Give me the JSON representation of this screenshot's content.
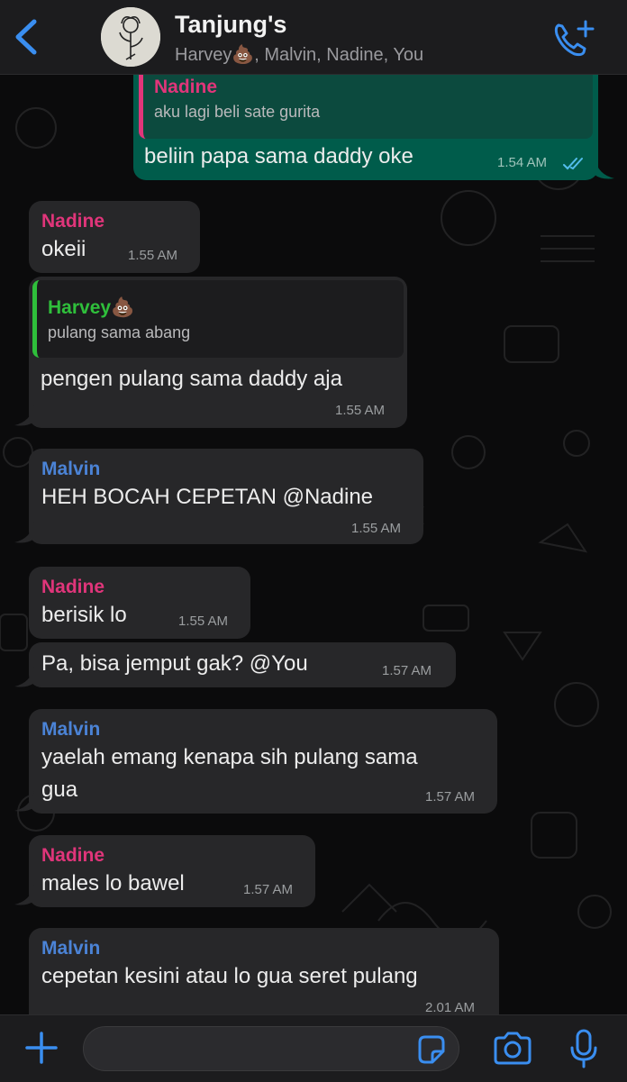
{
  "header": {
    "title": "Tanjung's",
    "members": "Harvey💩, Malvin, Nadine, You"
  },
  "messages": [
    {
      "sender": "Nadine",
      "quote_text": "aku lagi beli sate gurita",
      "text": "beliin papa sama daddy oke",
      "time": "1.54 AM",
      "status": "read"
    },
    {
      "sender": "Nadine",
      "text": "okeii",
      "time": "1.55 AM"
    },
    {
      "quote_sender": "Harvey💩",
      "quote_text": "pulang sama abang",
      "text": "pengen pulang sama daddy aja",
      "time": "1.55 AM"
    },
    {
      "sender": "Malvin",
      "text": "HEH BOCAH CEPETAN @Nadine",
      "time": "1.55 AM"
    },
    {
      "sender": "Nadine",
      "text": "berisik lo",
      "time": "1.55 AM"
    },
    {
      "text": "Pa, bisa jemput gak? @You",
      "time": "1.57 AM"
    },
    {
      "sender": "Malvin",
      "text_line1": "yaelah emang kenapa sih pulang sama",
      "text_line2": "gua",
      "time": "1.57 AM"
    },
    {
      "sender": "Nadine",
      "text": "males lo bawel",
      "time": "1.57 AM"
    },
    {
      "sender": "Malvin",
      "text": "cepetan kesini atau lo gua seret pulang",
      "time": "2.01 AM"
    }
  ],
  "composer": {
    "plus_icon": "plus-icon",
    "sticker_icon": "sticker-icon",
    "camera_icon": "camera-icon",
    "mic_icon": "microphone-icon"
  },
  "colors": {
    "nadine": "#e0357a",
    "malvin": "#4b83d6",
    "harvey": "#2fbf3b",
    "outgoing_bubble": "#005c4b",
    "incoming_bubble": "#272729",
    "accent": "#3a8ef0"
  }
}
